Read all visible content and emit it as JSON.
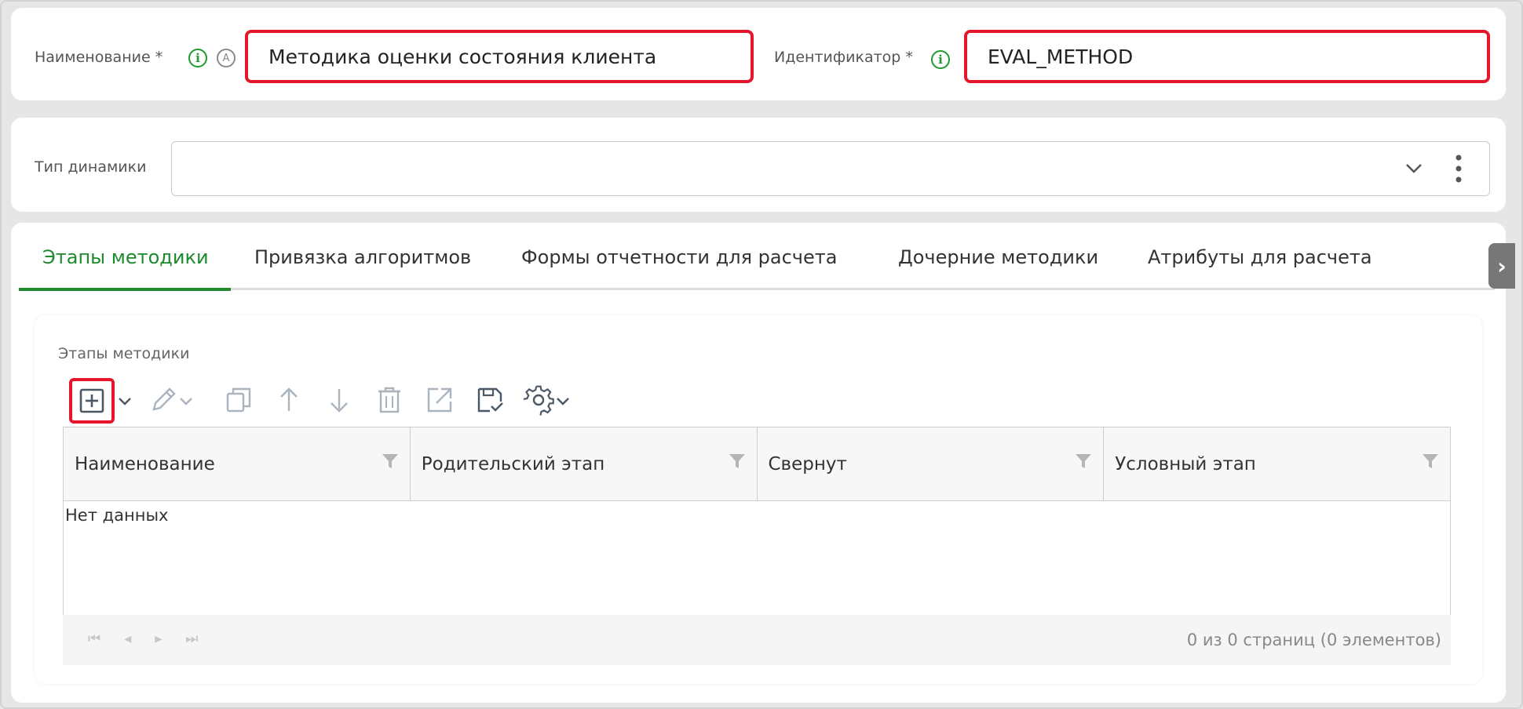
{
  "header": {
    "name_label": "Наименование *",
    "name_value": "Методика оценки состояния клиента",
    "identifier_label": "Идентификатор *",
    "identifier_value": "EVAL_METHOD"
  },
  "dynamics": {
    "label": "Тип динамики",
    "value": ""
  },
  "tabs": [
    {
      "label": "Этапы методики",
      "active": true
    },
    {
      "label": "Привязка алгоритмов"
    },
    {
      "label": "Формы отчетности для расчета"
    },
    {
      "label": "Дочерние методики"
    },
    {
      "label": "Атрибуты для расчета"
    }
  ],
  "stages": {
    "title": "Этапы методики",
    "toolbar": [
      "add-icon",
      "edit-icon",
      "copy-icon",
      "arrow-up-icon",
      "arrow-down-icon",
      "trash-icon",
      "export-icon",
      "save-icon",
      "gear-icon"
    ],
    "columns": [
      "Наименование",
      "Родительский этап",
      "Свернут",
      "Условный этап"
    ],
    "empty_text": "Нет данных",
    "pager_info": "0 из 0 страниц (0 элементов)"
  },
  "colors": {
    "accent": "#1e8a2e",
    "highlight": "#e5162b"
  }
}
